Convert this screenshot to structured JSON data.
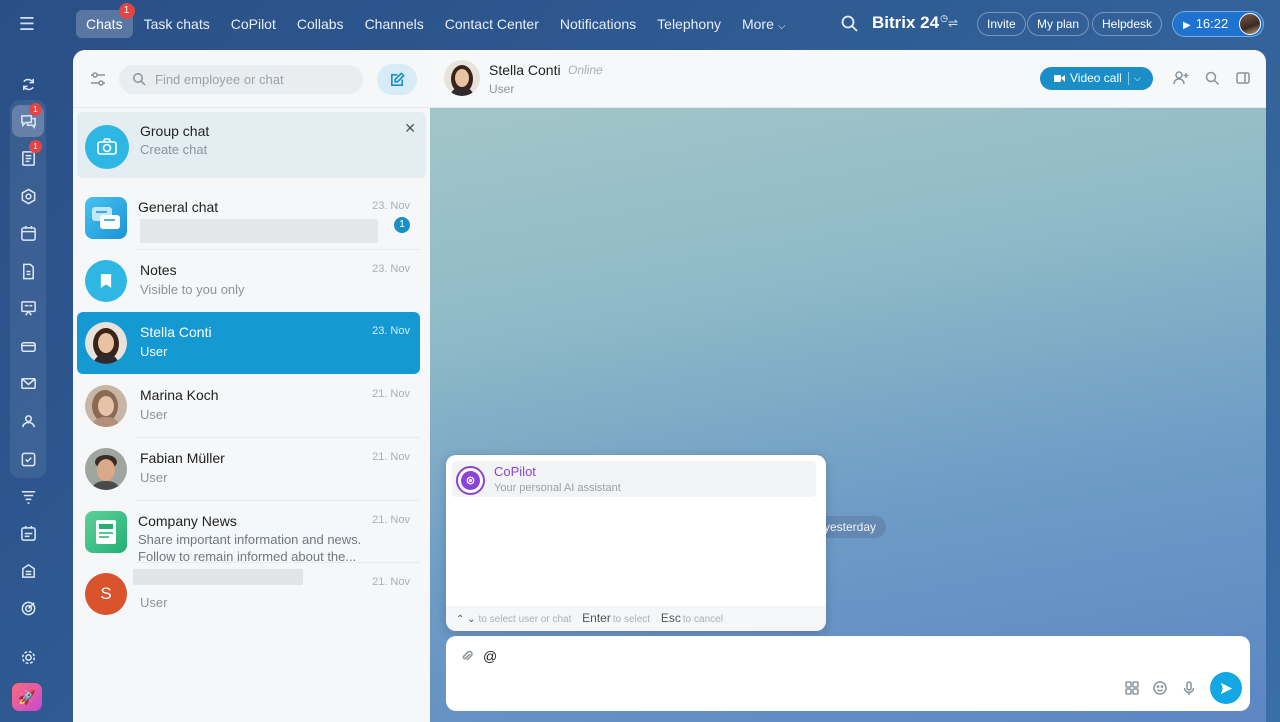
{
  "topnav": {
    "items": [
      {
        "label": "Chats",
        "active": true,
        "badge": "1"
      },
      {
        "label": "Task chats"
      },
      {
        "label": "CoPilot"
      },
      {
        "label": "Collabs"
      },
      {
        "label": "Channels"
      },
      {
        "label": "Contact Center"
      },
      {
        "label": "Notifications"
      },
      {
        "label": "Telephony"
      },
      {
        "label": "More"
      }
    ],
    "brand": "Bitrix 24",
    "invite": "Invite",
    "myplan": "My plan",
    "helpdesk": "Helpdesk",
    "timer": "16:22"
  },
  "rail": {
    "badges": {
      "messenger": "1",
      "feed": "1"
    }
  },
  "chatlist": {
    "search_placeholder": "Find employee or chat",
    "group_card": {
      "title": "Group chat",
      "subtitle": "Create chat"
    },
    "items": [
      {
        "name": "General chat",
        "date": "23. Nov",
        "unread": "1"
      },
      {
        "name": "Notes",
        "sub": "Visible to you only",
        "date": "23. Nov"
      },
      {
        "name": "Stella Conti",
        "sub": "User",
        "date": "23. Nov"
      },
      {
        "name": "Marina Koch",
        "sub": "User",
        "date": "21. Nov"
      },
      {
        "name": "Fabian Müller",
        "sub": "User",
        "date": "21. Nov"
      },
      {
        "name": "Company News",
        "sub": "Share important information and news.",
        "sub2": "Follow to remain informed about the...",
        "date": "21. Nov"
      },
      {
        "sub": "User",
        "date": "21. Nov",
        "initial": "S"
      }
    ]
  },
  "chat": {
    "name": "Stella Conti",
    "status": "Online",
    "role": "User",
    "video_call": "Video call",
    "date_chip": "yesterday",
    "mention_popup": {
      "title": "CoPilot",
      "desc": "Your personal AI assistant",
      "hint_select": "to select user or chat",
      "enter_key": "Enter",
      "enter_hint": "to select",
      "esc_key": "Esc",
      "esc_hint": "to cancel"
    },
    "composer_value": "@"
  },
  "colors": {
    "accent": "#1599d2",
    "copilot": "#8b44d8",
    "badge": "#e24545"
  }
}
